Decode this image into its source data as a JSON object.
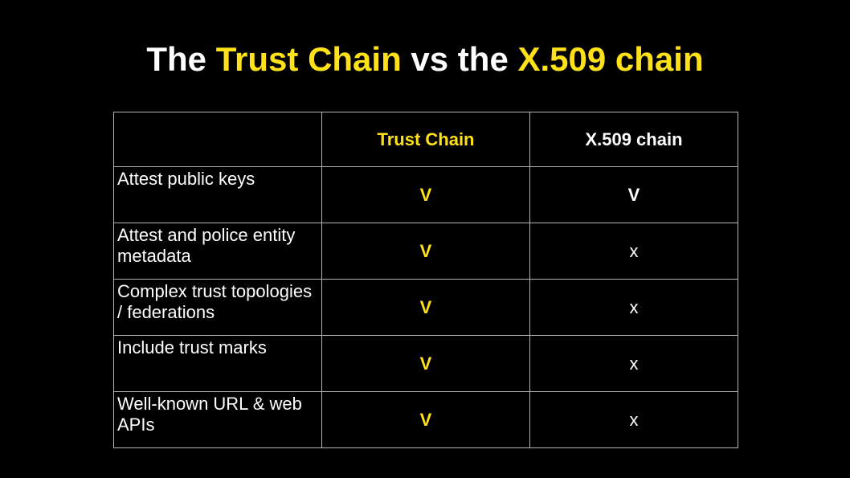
{
  "title": {
    "part1": "The ",
    "part2": "Trust Chain",
    "part3": " vs the ",
    "part4": "X.509 chain"
  },
  "table": {
    "headers": [
      "",
      "Trust Chain",
      "X.509 chain"
    ],
    "rows": [
      {
        "feature": "Attest public keys",
        "trust_chain": "V",
        "x509": "V"
      },
      {
        "feature": "Attest and police entity metadata",
        "trust_chain": "V",
        "x509": "x"
      },
      {
        "feature": "Complex trust topologies / federations",
        "trust_chain": "V",
        "x509": "x"
      },
      {
        "feature": "Include trust marks",
        "trust_chain": "V",
        "x509": "x"
      },
      {
        "feature": "Well-known URL & web APIs",
        "trust_chain": "V",
        "x509": "x"
      }
    ]
  },
  "colors": {
    "accent": "#ffe11a",
    "text": "#ffffff",
    "background": "#000000",
    "grid": "#b3b3b3"
  }
}
